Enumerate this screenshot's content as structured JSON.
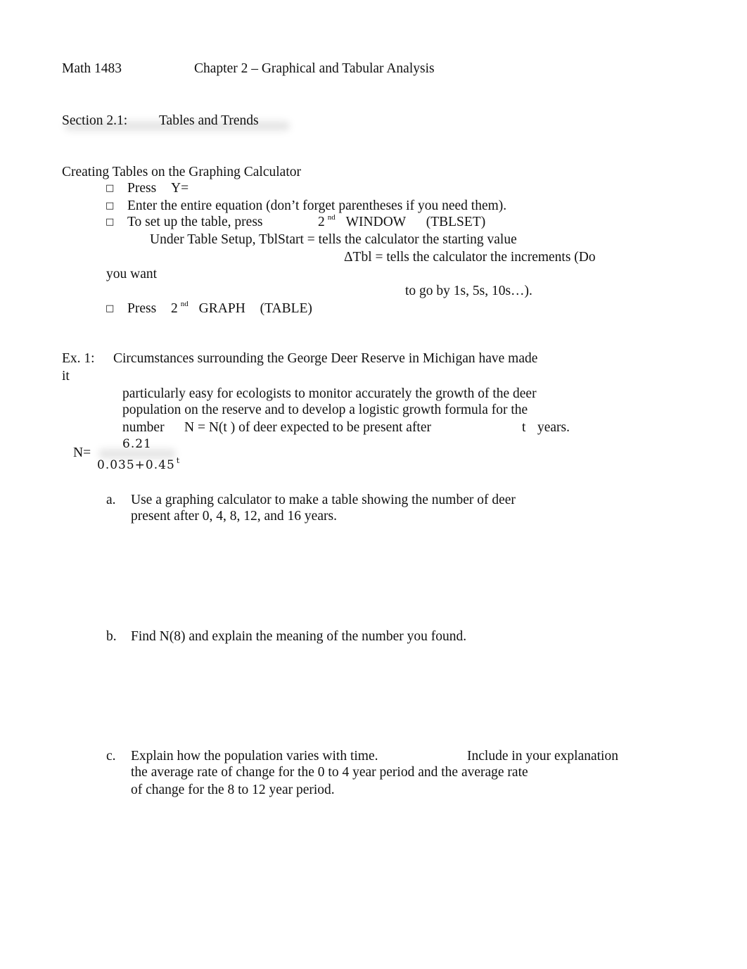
{
  "header": {
    "course": "Math 1483",
    "chapter": "Chapter 2 – Graphical and Tabular Analysis"
  },
  "section": {
    "label": "Section 2.1:",
    "title": "Tables and Trends"
  },
  "calculator": {
    "heading": "Creating Tables on the Graphing Calculator",
    "bullet_glyph": "□",
    "step1": {
      "press": "Press",
      "key": "Y="
    },
    "step2": {
      "text": "Enter the entire equation (don’t forget parentheses if you need them)."
    },
    "step3": {
      "text": "To set up the table, press",
      "key_num": "2",
      "key_sup": "nd",
      "key": "WINDOW",
      "paren": "(TBLSET)"
    },
    "setup_line1": "Under Table Setup, TblStart = tells the calculator the starting value",
    "setup_line2": "ΔTbl = tells the calculator the increments (Do",
    "setup_line3": "you want",
    "setup_line4": "to go by 1s, 5s, 10s…).",
    "step4": {
      "press": "Press",
      "key_num": "2",
      "key_sup": "nd",
      "key": "GRAPH",
      "paren": "(TABLE)"
    }
  },
  "example": {
    "label": "Ex. 1:",
    "line1": "Circumstances surrounding the George Deer Reserve in Michigan have made",
    "line1_wrap": "it",
    "line2": "particularly easy for ecologists to monitor accurately the growth of the deer",
    "line3": "population on the reserve and to develop a logistic growth formula for the",
    "line4_a": "number",
    "line4_b": "N =  N(t ) of deer expected to be present after",
    "line4_c": "t",
    "line4_d": "years.",
    "formula": {
      "lhs": "N=",
      "numerator": "6.21",
      "denominator": "0.035+0.45",
      "exponent": "t"
    }
  },
  "questions": [
    {
      "letter": "a.",
      "lines": [
        "Use a graphing calculator to make a table showing the number of deer",
        "present after 0, 4, 8, 12, and 16 years."
      ]
    },
    {
      "letter": "b.",
      "lines": [
        "Find  N(8) and explain the meaning of the number you found."
      ]
    },
    {
      "letter": "c.",
      "line1_a": "Explain how the population varies with time.",
      "line1_b": "Include in your explanation",
      "lines": [
        "the average rate of change for the 0 to 4 year period and the average rate",
        "of change for the 8 to 12 year period."
      ]
    }
  ]
}
